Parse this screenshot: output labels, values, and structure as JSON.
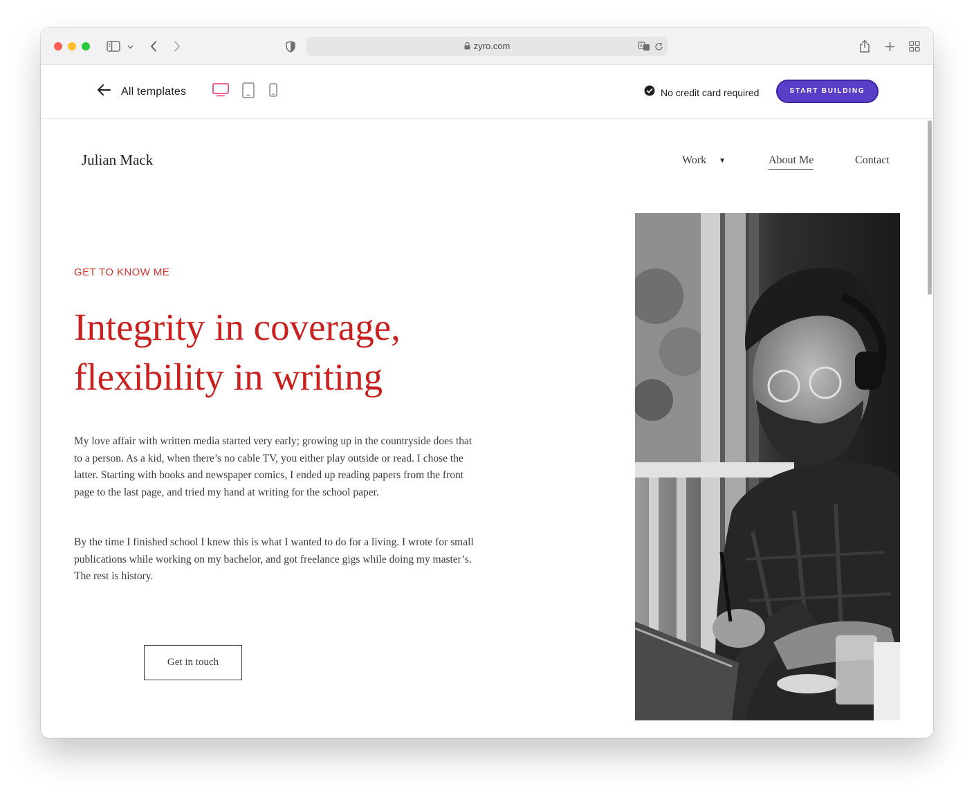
{
  "browser": {
    "url": "zyro.com"
  },
  "toolbar": {
    "back_label": "All templates",
    "no_credit_card": "No credit card required",
    "start_button": "START BUILDING",
    "active_device": "desktop",
    "accent_color": "#5a3ec8",
    "device_active_color": "#e8336f"
  },
  "site": {
    "logo": "Julian Mack",
    "nav": {
      "work": "Work",
      "about": "About Me",
      "contact": "Contact"
    },
    "eyebrow": "GET TO KNOW ME",
    "headline_line1": "Integrity in coverage,",
    "headline_line2": "flexibility in writing",
    "paragraph1": "My love affair with written media started very early; growing up in the countryside does that to a person. As a kid, when there’s no cable TV, you either play outside or read. I chose the latter. Starting with books and newspaper comics, I ended up reading papers from the front page to the last page, and tried my hand at writing for the school paper.",
    "paragraph2": "By the time I finished school I knew this is what I wanted to do for a living. I wrote for small publications while working on my bachelor, and got freelance gigs while doing my master’s. The rest is history.",
    "cta": "Get in touch",
    "headline_color": "#c8211f",
    "eyebrow_color": "#d4342c"
  }
}
